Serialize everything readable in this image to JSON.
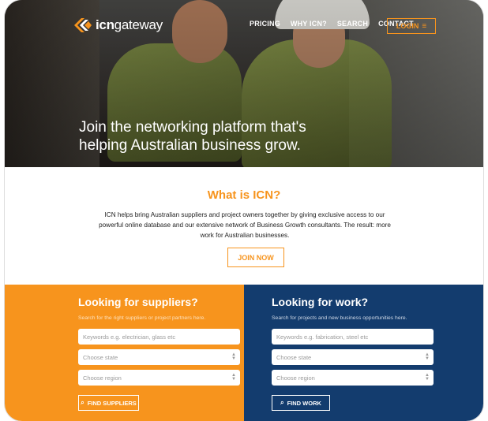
{
  "header": {
    "logo_bold": "icn",
    "logo_light": "gateway",
    "nav": [
      "PRICING",
      "WHY ICN?",
      "SEARCH",
      "CONTACT"
    ],
    "login_label": "LOGIN",
    "login_icon": "menu-icon"
  },
  "hero": {
    "title": "Join the networking platform that's helping Australian business grow."
  },
  "about": {
    "title": "What is ICN?",
    "body": "ICN helps bring Australian suppliers and project owners together by giving exclusive access to our powerful online database and our extensive network of Business Growth consultants. The result: more work for Australian businesses.",
    "join_label": "JOIN NOW"
  },
  "suppliers": {
    "title": "Looking for suppliers?",
    "subtitle": "Search for the right suppliers or project partners here.",
    "keyword_placeholder": "Keywords e.g. electrician, glass etc",
    "state_placeholder": "Choose state",
    "region_placeholder": "Choose region",
    "button_label": "FIND SUPPLIERS"
  },
  "work": {
    "title": "Looking for work?",
    "subtitle": "Search for projects and new business opportunities here.",
    "keyword_placeholder": "Keywords e.g. fabrication, steel etc",
    "state_placeholder": "Choose state",
    "region_placeholder": "Choose region",
    "button_label": "FIND WORK"
  },
  "colors": {
    "accent_orange": "#f7941d",
    "navy": "#133c6e"
  }
}
